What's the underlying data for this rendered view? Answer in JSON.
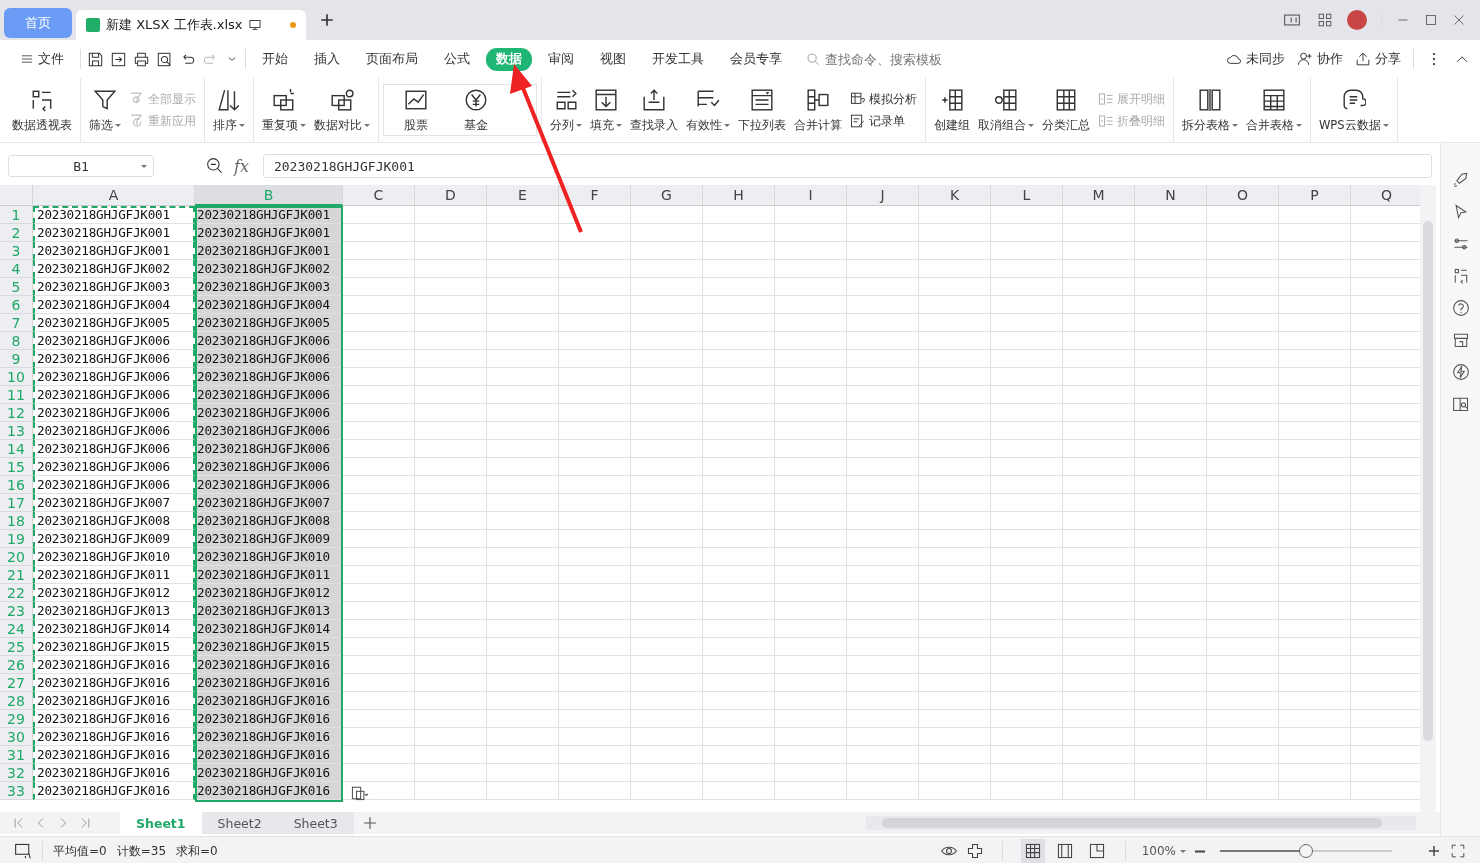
{
  "title_bar": {
    "tabs": [
      {
        "label": "首页",
        "kind": "home",
        "selected": false
      },
      {
        "label": "新建 XLSX 工作表.xlsx",
        "kind": "doc",
        "selected": true
      }
    ]
  },
  "menu": {
    "file": "文件",
    "tabs": [
      {
        "label": "开始",
        "selected": false
      },
      {
        "label": "插入",
        "selected": false
      },
      {
        "label": "页面布局",
        "selected": false
      },
      {
        "label": "公式",
        "selected": false
      },
      {
        "label": "数据",
        "selected": true
      },
      {
        "label": "审阅",
        "selected": false
      },
      {
        "label": "视图",
        "selected": false
      },
      {
        "label": "开发工具",
        "selected": false
      },
      {
        "label": "会员专享",
        "selected": false
      }
    ],
    "search": {
      "placeholder": "查找命令、搜索模板"
    },
    "actions": [
      "未同步",
      "协作",
      "分享"
    ]
  },
  "ribbon": {
    "groups": [
      {
        "items": [
          {
            "kind": "big",
            "label": "数据透视表",
            "caret": false
          }
        ]
      },
      {
        "items": [
          {
            "kind": "big",
            "label": "筛选",
            "caret": true
          },
          {
            "kind": "stack",
            "entries": [
              {
                "label": "全部显示",
                "disabled": true
              },
              {
                "label": "重新应用",
                "disabled": true
              }
            ]
          }
        ]
      },
      {
        "items": [
          {
            "kind": "big",
            "label": "排序",
            "caret": true
          }
        ]
      },
      {
        "items": [
          {
            "kind": "big",
            "label": "重复项",
            "caret": true
          },
          {
            "kind": "big",
            "label": "数据对比",
            "caret": true
          }
        ]
      },
      {
        "items": [
          {
            "kind": "gallery",
            "entries": [
              {
                "label": "股票"
              },
              {
                "label": "基金"
              }
            ]
          }
        ]
      },
      {
        "items": [
          {
            "kind": "big",
            "label": "分列",
            "caret": true
          },
          {
            "kind": "big",
            "label": "填充",
            "caret": true
          },
          {
            "kind": "big",
            "label": "查找录入",
            "caret": false
          },
          {
            "kind": "big",
            "label": "有效性",
            "caret": true
          },
          {
            "kind": "big",
            "label": "下拉列表",
            "caret": false
          },
          {
            "kind": "big",
            "label": "合并计算",
            "caret": false
          },
          {
            "kind": "stack",
            "entries": [
              {
                "label": "模拟分析",
                "disabled": false
              },
              {
                "label": "记录单",
                "disabled": false
              }
            ]
          }
        ]
      },
      {
        "items": [
          {
            "kind": "big",
            "label": "创建组",
            "caret": false
          },
          {
            "kind": "big",
            "label": "取消组合",
            "caret": true
          },
          {
            "kind": "big",
            "label": "分类汇总",
            "caret": false
          },
          {
            "kind": "stack",
            "entries": [
              {
                "label": "展开明细",
                "disabled": true
              },
              {
                "label": "折叠明细",
                "disabled": true
              }
            ]
          }
        ]
      },
      {
        "items": [
          {
            "kind": "big",
            "label": "拆分表格",
            "caret": true
          },
          {
            "kind": "big",
            "label": "合并表格",
            "caret": true
          }
        ]
      },
      {
        "items": [
          {
            "kind": "big",
            "label": "WPS云数据",
            "caret": true
          }
        ]
      }
    ]
  },
  "formula_bar": {
    "name_box": "B1",
    "fx": "fx",
    "value": "20230218GHJGFJK001"
  },
  "grid": {
    "columns": [
      {
        "label": "A",
        "selected": false,
        "copied": true
      },
      {
        "label": "B",
        "selected": true,
        "copied": false
      },
      {
        "label": "C",
        "selected": false,
        "copied": false
      },
      {
        "label": "D",
        "selected": false,
        "copied": false
      },
      {
        "label": "E",
        "selected": false,
        "copied": false
      },
      {
        "label": "F",
        "selected": false,
        "copied": false
      },
      {
        "label": "G",
        "selected": false,
        "copied": false
      },
      {
        "label": "H",
        "selected": false,
        "copied": false
      },
      {
        "label": "I",
        "selected": false,
        "copied": false
      },
      {
        "label": "J",
        "selected": false,
        "copied": false
      },
      {
        "label": "K",
        "selected": false,
        "copied": false
      },
      {
        "label": "L",
        "selected": false,
        "copied": false
      },
      {
        "label": "M",
        "selected": false,
        "copied": false
      },
      {
        "label": "N",
        "selected": false,
        "copied": false
      },
      {
        "label": "O",
        "selected": false,
        "copied": false
      },
      {
        "label": "P",
        "selected": false,
        "copied": false
      },
      {
        "label": "Q",
        "selected": false,
        "copied": false
      }
    ],
    "rows": [
      {
        "label": "1",
        "selected": true,
        "cells": [
          "20230218GHJGFJK001",
          "20230218GHJGFJK001"
        ]
      },
      {
        "label": "2",
        "selected": true,
        "cells": [
          "20230218GHJGFJK001",
          "20230218GHJGFJK001"
        ]
      },
      {
        "label": "3",
        "selected": true,
        "cells": [
          "20230218GHJGFJK001",
          "20230218GHJGFJK001"
        ]
      },
      {
        "label": "4",
        "selected": true,
        "cells": [
          "20230218GHJGFJK002",
          "20230218GHJGFJK002"
        ]
      },
      {
        "label": "5",
        "selected": true,
        "cells": [
          "20230218GHJGFJK003",
          "20230218GHJGFJK003"
        ]
      },
      {
        "label": "6",
        "selected": true,
        "cells": [
          "20230218GHJGFJK004",
          "20230218GHJGFJK004"
        ]
      },
      {
        "label": "7",
        "selected": true,
        "cells": [
          "20230218GHJGFJK005",
          "20230218GHJGFJK005"
        ]
      },
      {
        "label": "8",
        "selected": true,
        "cells": [
          "20230218GHJGFJK006",
          "20230218GHJGFJK006"
        ]
      },
      {
        "label": "9",
        "selected": true,
        "cells": [
          "20230218GHJGFJK006",
          "20230218GHJGFJK006"
        ]
      },
      {
        "label": "10",
        "selected": true,
        "cells": [
          "20230218GHJGFJK006",
          "20230218GHJGFJK006"
        ]
      },
      {
        "label": "11",
        "selected": true,
        "cells": [
          "20230218GHJGFJK006",
          "20230218GHJGFJK006"
        ]
      },
      {
        "label": "12",
        "selected": true,
        "cells": [
          "20230218GHJGFJK006",
          "20230218GHJGFJK006"
        ]
      },
      {
        "label": "13",
        "selected": true,
        "cells": [
          "20230218GHJGFJK006",
          "20230218GHJGFJK006"
        ]
      },
      {
        "label": "14",
        "selected": true,
        "cells": [
          "20230218GHJGFJK006",
          "20230218GHJGFJK006"
        ]
      },
      {
        "label": "15",
        "selected": true,
        "cells": [
          "20230218GHJGFJK006",
          "20230218GHJGFJK006"
        ]
      },
      {
        "label": "16",
        "selected": true,
        "cells": [
          "20230218GHJGFJK006",
          "20230218GHJGFJK006"
        ]
      },
      {
        "label": "17",
        "selected": true,
        "cells": [
          "20230218GHJGFJK007",
          "20230218GHJGFJK007"
        ]
      },
      {
        "label": "18",
        "selected": true,
        "cells": [
          "20230218GHJGFJK008",
          "20230218GHJGFJK008"
        ]
      },
      {
        "label": "19",
        "selected": true,
        "cells": [
          "20230218GHJGFJK009",
          "20230218GHJGFJK009"
        ]
      },
      {
        "label": "20",
        "selected": true,
        "cells": [
          "20230218GHJGFJK010",
          "20230218GHJGFJK010"
        ]
      },
      {
        "label": "21",
        "selected": true,
        "cells": [
          "20230218GHJGFJK011",
          "20230218GHJGFJK011"
        ]
      },
      {
        "label": "22",
        "selected": true,
        "cells": [
          "20230218GHJGFJK012",
          "20230218GHJGFJK012"
        ]
      },
      {
        "label": "23",
        "selected": true,
        "cells": [
          "20230218GHJGFJK013",
          "20230218GHJGFJK013"
        ]
      },
      {
        "label": "24",
        "selected": true,
        "cells": [
          "20230218GHJGFJK014",
          "20230218GHJGFJK014"
        ]
      },
      {
        "label": "25",
        "selected": true,
        "cells": [
          "20230218GHJGFJK015",
          "20230218GHJGFJK015"
        ]
      },
      {
        "label": "26",
        "selected": true,
        "cells": [
          "20230218GHJGFJK016",
          "20230218GHJGFJK016"
        ]
      },
      {
        "label": "27",
        "selected": true,
        "cells": [
          "20230218GHJGFJK016",
          "20230218GHJGFJK016"
        ]
      },
      {
        "label": "28",
        "selected": true,
        "cells": [
          "20230218GHJGFJK016",
          "20230218GHJGFJK016"
        ]
      },
      {
        "label": "29",
        "selected": true,
        "cells": [
          "20230218GHJGFJK016",
          "20230218GHJGFJK016"
        ]
      },
      {
        "label": "30",
        "selected": true,
        "cells": [
          "20230218GHJGFJK016",
          "20230218GHJGFJK016"
        ]
      },
      {
        "label": "31",
        "selected": true,
        "cells": [
          "20230218GHJGFJK016",
          "20230218GHJGFJK016"
        ]
      },
      {
        "label": "32",
        "selected": true,
        "cells": [
          "20230218GHJGFJK016",
          "20230218GHJGFJK016"
        ]
      },
      {
        "label": "33",
        "selected": true,
        "cells": [
          "20230218GHJGFJK016",
          "20230218GHJGFJK016"
        ]
      }
    ]
  },
  "sheet_tabs": [
    {
      "label": "Sheet1",
      "selected": true
    },
    {
      "label": "Sheet2",
      "selected": false
    },
    {
      "label": "Sheet3",
      "selected": false
    }
  ],
  "status_bar": {
    "stats": [
      "平均值=0",
      "计数=35",
      "求和=0"
    ],
    "zoom": "100%",
    "zoom_slider": {
      "level": 0.5
    }
  }
}
